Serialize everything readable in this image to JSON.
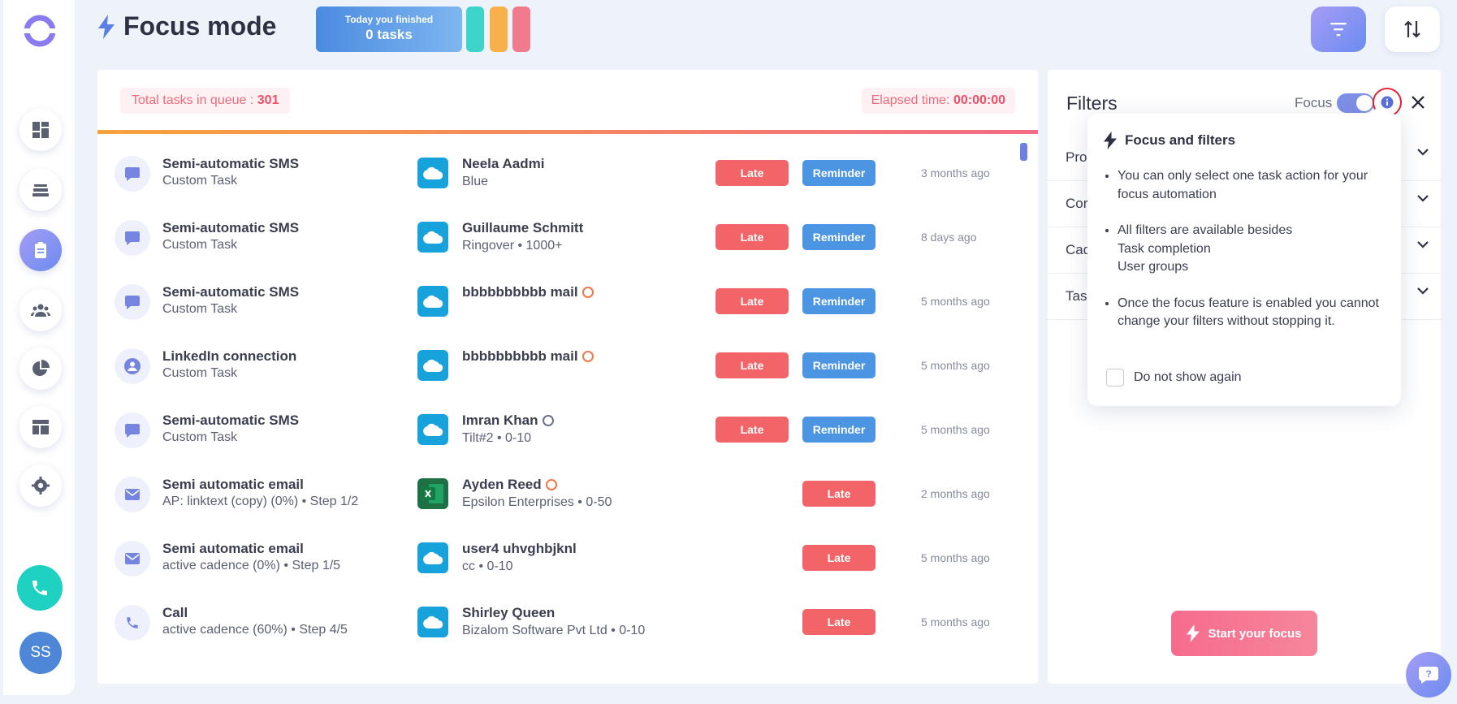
{
  "app": {
    "title": "Focus mode"
  },
  "header": {
    "finished_line1": "Today you finished",
    "finished_line2": "0 tasks",
    "pills": [
      "#3fd4c9",
      "#f8b04a",
      "#f27a8f"
    ],
    "filter_icon": "filter-icon",
    "sort_icon": "sort-icon"
  },
  "sidebar": {
    "items": [
      {
        "name": "dashboard-icon"
      },
      {
        "name": "stack-icon"
      },
      {
        "name": "tasks-icon",
        "active": true
      },
      {
        "name": "people-icon"
      },
      {
        "name": "pie-chart-icon"
      },
      {
        "name": "layout-icon"
      },
      {
        "name": "settings-icon"
      }
    ],
    "avatar": "SS"
  },
  "queue": {
    "total_label": "Total tasks in queue : ",
    "total_value": "301",
    "elapsed_label": "Elapsed time: ",
    "elapsed_value": "00:00:00"
  },
  "tasks": [
    {
      "icon": "sms",
      "name": "Semi-automatic SMS",
      "sub": "Custom Task",
      "source": "salesforce",
      "contact": "Neela Aadmi",
      "contact_sub": "Blue",
      "badge": "",
      "late": "Late",
      "reminder": "Reminder",
      "ago": "3 months ago"
    },
    {
      "icon": "sms",
      "name": "Semi-automatic SMS",
      "sub": "Custom Task",
      "source": "salesforce",
      "contact": "Guillaume Schmitt",
      "contact_sub": "Ringover • 1000+",
      "badge": "",
      "late": "Late",
      "reminder": "Reminder",
      "ago": "8 days ago"
    },
    {
      "icon": "sms",
      "name": "Semi-automatic SMS",
      "sub": "Custom Task",
      "source": "salesforce",
      "contact": "bbbbbbbbbb mail",
      "contact_sub": "",
      "badge": "orange",
      "late": "Late",
      "reminder": "Reminder",
      "ago": "5 months ago"
    },
    {
      "icon": "linkedin",
      "name": "LinkedIn connection",
      "sub": "Custom Task",
      "source": "salesforce",
      "contact": "bbbbbbbbbb mail",
      "contact_sub": "",
      "badge": "orange",
      "late": "Late",
      "reminder": "Reminder",
      "ago": "5 months ago"
    },
    {
      "icon": "sms",
      "name": "Semi-automatic SMS",
      "sub": "Custom Task",
      "source": "salesforce",
      "contact": "Imran Khan",
      "contact_sub": "Tilt#2 • 0-10",
      "badge": "grey",
      "late": "Late",
      "reminder": "Reminder",
      "ago": "5 months ago"
    },
    {
      "icon": "email",
      "name": "Semi automatic email",
      "sub": "AP: linktext (copy) (0%) • Step 1/2",
      "source": "excel",
      "contact": "Ayden Reed",
      "contact_sub": "Epsilon Enterprises • 0-50",
      "badge": "orange",
      "late": "Late",
      "reminder": "",
      "ago": "2 months ago"
    },
    {
      "icon": "email",
      "name": "Semi automatic email",
      "sub": "active cadence (0%) • Step 1/5",
      "source": "salesforce",
      "contact": "user4 uhvghbjknl",
      "contact_sub": "cc • 0-10",
      "badge": "",
      "late": "Late",
      "reminder": "",
      "ago": "5 months ago"
    },
    {
      "icon": "call",
      "name": "Call",
      "sub": "active cadence (60%) • Step 4/5",
      "source": "salesforce",
      "contact": "Shirley Queen",
      "contact_sub": "Bizalom Software Pvt Ltd • 0-10",
      "badge": "",
      "late": "Late",
      "reminder": "",
      "ago": "5 months ago"
    }
  ],
  "filters": {
    "title": "Filters",
    "focus_label": "Focus",
    "focus_on": true,
    "rows": [
      {
        "label": "Pro"
      },
      {
        "label": "Cor"
      },
      {
        "label": "Cad"
      },
      {
        "label": "Tas"
      }
    ],
    "start_label": "Start your focus"
  },
  "popover": {
    "title": "Focus and filters",
    "bullets": [
      {
        "lines": [
          "You can only select one task action for your focus automation"
        ]
      },
      {
        "lines": [
          "All filters are available besides",
          "Task completion",
          "User groups"
        ]
      },
      {
        "lines": [
          "Once the focus feature is enabled you cannot change your filters without stopping it."
        ]
      }
    ],
    "checkbox_label": "Do not show again"
  },
  "colors": {
    "accent": "#7e8fe6",
    "late": "#f26467",
    "reminder": "#4c95e3",
    "danger_text": "#ee4f69"
  }
}
